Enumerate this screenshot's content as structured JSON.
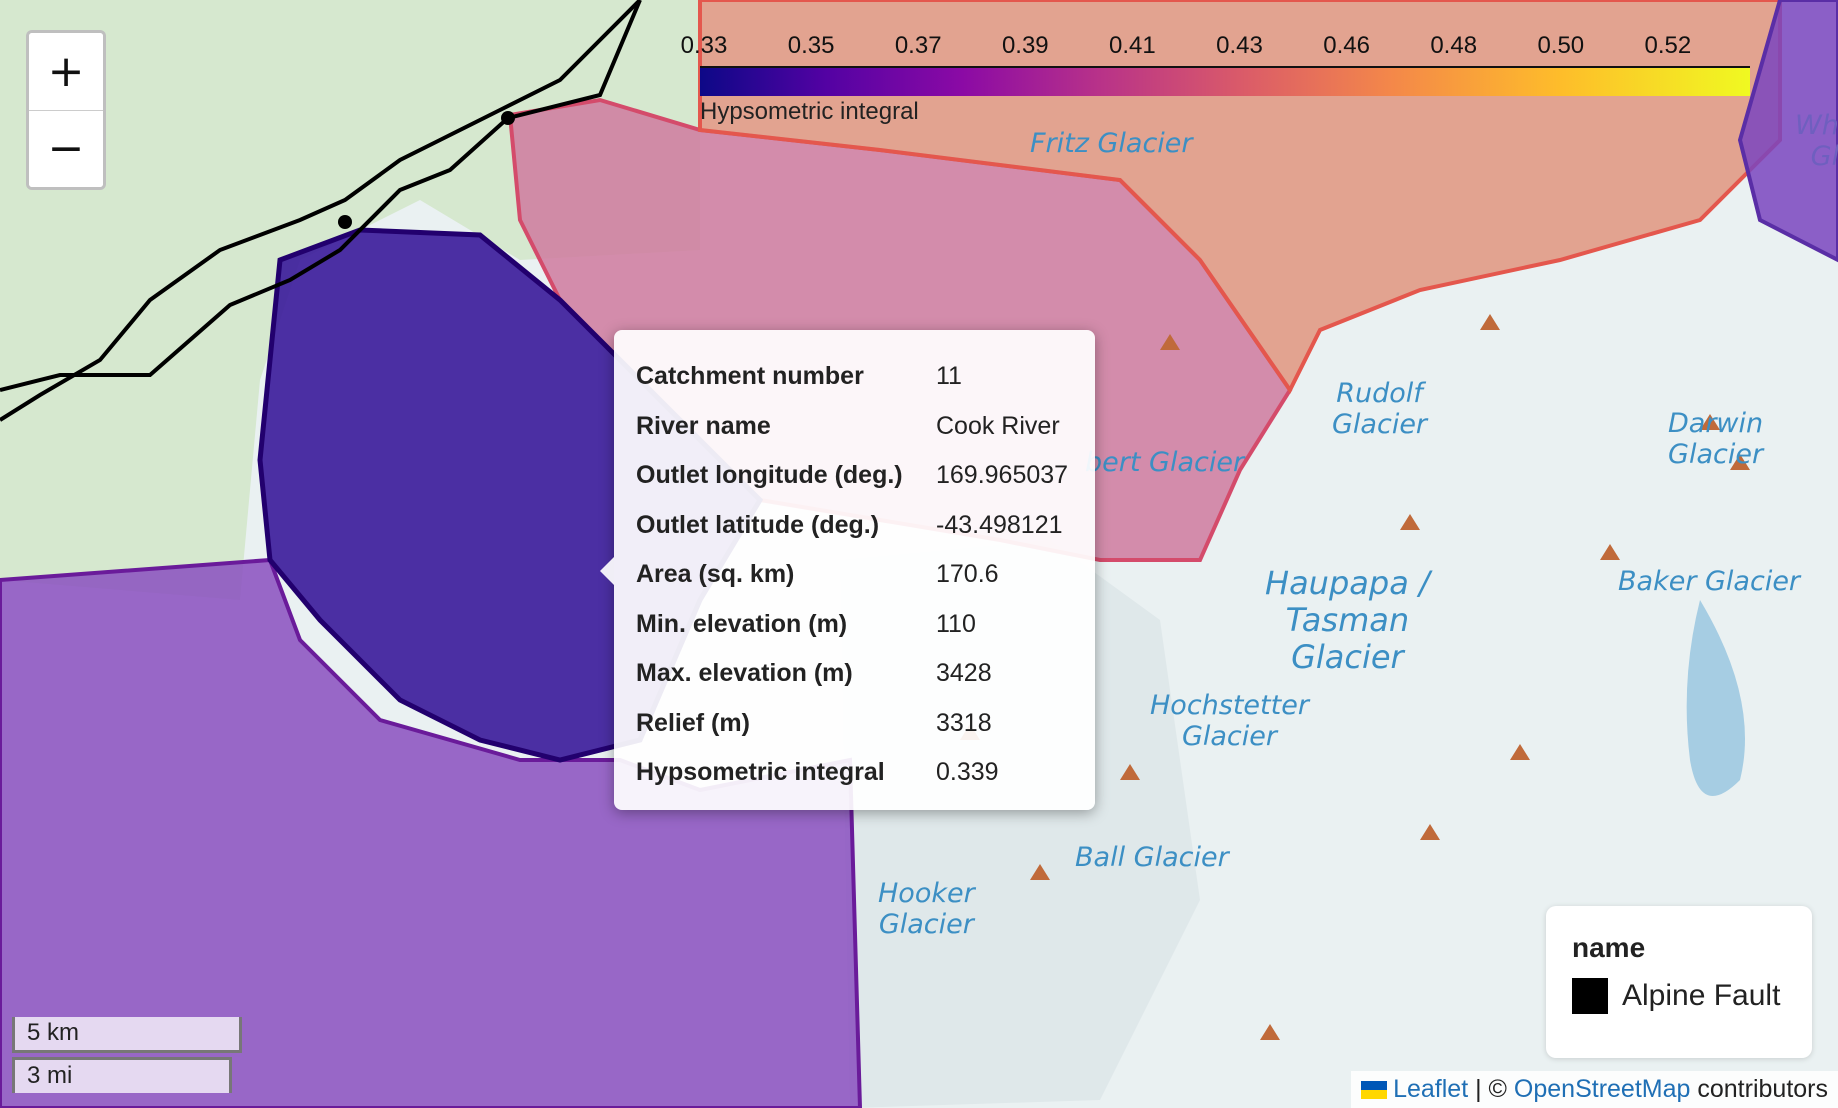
{
  "zoom": {
    "in_label": "+",
    "out_label": "−"
  },
  "colorbar": {
    "ticks": [
      "0.33",
      "0.35",
      "0.37",
      "0.39",
      "0.41",
      "0.43",
      "0.46",
      "0.48",
      "0.50",
      "0.52"
    ],
    "caption": "Hypsometric integral",
    "colormap": "plasma"
  },
  "popup": {
    "rows": [
      {
        "key": "Catchment number",
        "value": "11"
      },
      {
        "key": "River name",
        "value": "Cook River"
      },
      {
        "key": "Outlet longitude (deg.)",
        "value": "169.965037"
      },
      {
        "key": "Outlet latitude (deg.)",
        "value": "-43.498121"
      },
      {
        "key": "Area (sq. km)",
        "value": "170.6"
      },
      {
        "key": "Min. elevation (m)",
        "value": "110"
      },
      {
        "key": "Max. elevation (m)",
        "value": "3428"
      },
      {
        "key": "Relief (m)",
        "value": "3318"
      },
      {
        "key": "Hypsometric integral",
        "value": "0.339"
      }
    ]
  },
  "map_labels": {
    "fritz": "Fritz Glacier",
    "albert": "bert Glacier",
    "rudolf": "Rudolf\nGlacier",
    "darwin": "Darwin\nGlacier",
    "tasman": "Haupapa /\nTasman\nGlacier",
    "baker": "Baker Glacier",
    "hochstetter": "Hochstetter\nGlacier",
    "ball": "Ball Glacier",
    "hooker": "Hooker\nGlacier",
    "whyte": "Why\nGl"
  },
  "legend": {
    "title": "name",
    "item": "Alpine Fault",
    "item_color": "#000000"
  },
  "scale": {
    "km": "5 km",
    "mi": "3 mi"
  },
  "attribution": {
    "leaflet": "Leaflet",
    "sep": "|",
    "copy": "©",
    "osm": "OpenStreetMap",
    "contributors": "contributors"
  },
  "colors": {
    "catchment_11": "#3a1a9a",
    "catchment_purple": "#8a4fc0",
    "catchment_pink": "#cf7a9f",
    "catchment_orange": "#e1957f"
  }
}
